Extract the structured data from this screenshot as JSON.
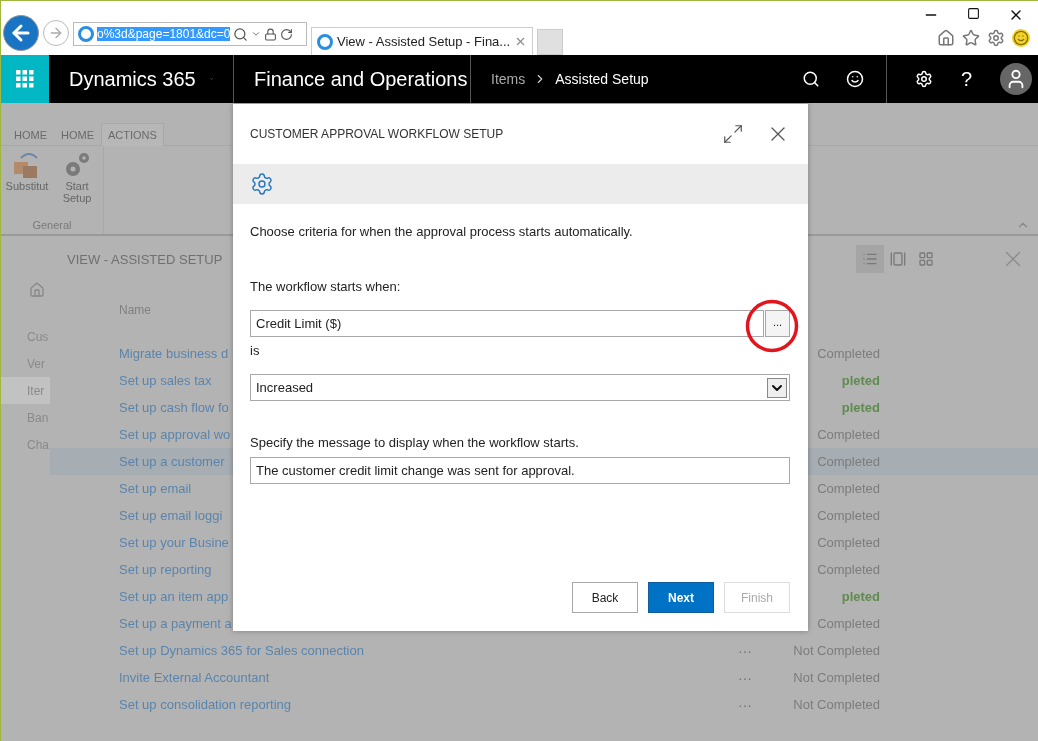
{
  "browser": {
    "address": "o%3d&page=1801&dc=0",
    "tab_title": "View - Assisted Setup - Fina..."
  },
  "nav": {
    "product": "Dynamics 365",
    "app": "Finance and Operations",
    "breadcrumb": [
      "Items",
      "Assisted Setup"
    ],
    "help": "?"
  },
  "ribbon": {
    "tabs": [
      {
        "label": "HOME",
        "selected": false
      },
      {
        "label": "HOME",
        "selected": false
      },
      {
        "label": "ACTIONS",
        "selected": true
      }
    ],
    "buttons": [
      {
        "label": "Substitut",
        "kind": "boxes"
      },
      {
        "label": "Start Setup",
        "kind": "gears"
      }
    ],
    "group": "General"
  },
  "page": {
    "title": "VIEW - ASSISTED SETUP",
    "sidebar": [
      {
        "label": "Cus",
        "selected": false
      },
      {
        "label": "Ver",
        "selected": false
      },
      {
        "label": "Iter",
        "selected": true
      },
      {
        "label": "Ban",
        "selected": false
      },
      {
        "label": "Cha",
        "selected": false
      }
    ],
    "views": [
      {
        "kind": "list",
        "selected": true
      },
      {
        "kind": "details",
        "selected": false
      },
      {
        "kind": "tiles",
        "selected": false
      }
    ],
    "column": "Name",
    "rows": [
      {
        "name": "Migrate business d",
        "status": "Completed",
        "completed": false,
        "selected": false
      },
      {
        "name": "Set up sales tax",
        "status": "pleted",
        "completed": true,
        "selected": false
      },
      {
        "name": "Set up cash flow fo",
        "status": "pleted",
        "completed": true,
        "selected": false
      },
      {
        "name": "Set up approval wo",
        "status": "Completed",
        "completed": false,
        "selected": false
      },
      {
        "name": "Set up a customer",
        "status": "Completed",
        "completed": false,
        "selected": true
      },
      {
        "name": "Set up email",
        "status": "Completed",
        "completed": false,
        "selected": false
      },
      {
        "name": "Set up email loggi",
        "status": "Completed",
        "completed": false,
        "selected": false
      },
      {
        "name": "Set up your Busine",
        "status": "Completed",
        "completed": false,
        "selected": false
      },
      {
        "name": "Set up reporting",
        "status": "Completed",
        "completed": false,
        "selected": false
      },
      {
        "name": "Set up an item app",
        "status": "pleted",
        "completed": true,
        "selected": false
      },
      {
        "name": "Set up a payment a",
        "status": "Completed",
        "completed": false,
        "selected": false
      },
      {
        "name": "Set up Dynamics 365 for Sales connection",
        "actions": "···",
        "status": "Not Completed",
        "completed": false,
        "selected": false
      },
      {
        "name": "Invite External Accountant",
        "actions": "···",
        "status": "Not Completed",
        "completed": false,
        "selected": false
      },
      {
        "name": "Set up consolidation reporting",
        "actions": "···",
        "status": "Not Completed",
        "completed": false,
        "selected": false
      }
    ]
  },
  "dialog": {
    "title": "CUSTOMER APPROVAL WORKFLOW SETUP",
    "intro": "Choose criteria for when the approval process starts automatically.",
    "fields": [
      {
        "kind": "lookup",
        "label": "The workflow starts when:",
        "value": "Credit Limit ($)",
        "button": "..."
      },
      {
        "kind": "select",
        "label": "is",
        "value": "Increased"
      },
      {
        "kind": "text",
        "label": "Specify the message to display when the workflow starts.",
        "value": "The customer credit limit change was sent for approval."
      }
    ],
    "annotations": [
      {
        "kind": "circle"
      }
    ],
    "buttons": [
      {
        "label": "Back",
        "kind": "default",
        "disabled": false
      },
      {
        "label": "Next",
        "kind": "primary",
        "disabled": false
      },
      {
        "label": "Finish",
        "kind": "default",
        "disabled": true
      }
    ]
  }
}
